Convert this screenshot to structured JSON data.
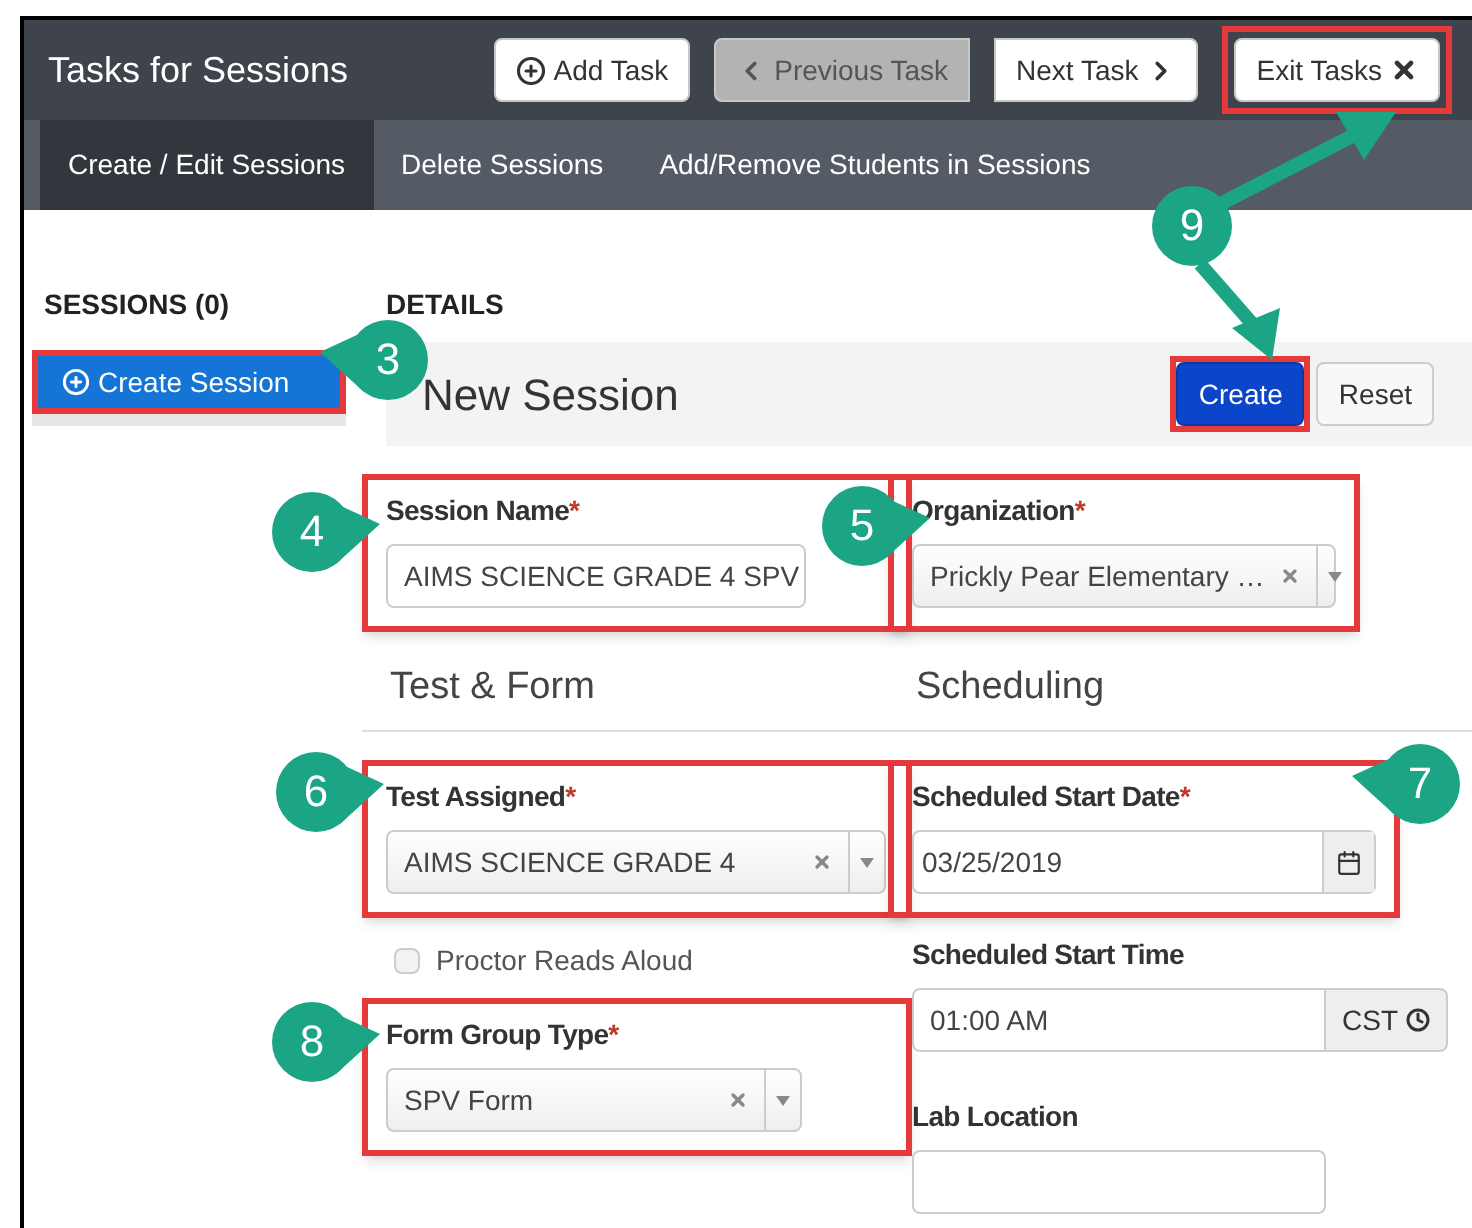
{
  "header": {
    "title": "Tasks for Sessions",
    "buttons": [
      {
        "label": "Add Task",
        "kind": "add",
        "disabled": false,
        "highlighted": false
      },
      {
        "label": "Previous Task",
        "kind": "previous",
        "disabled": true,
        "highlighted": false
      },
      {
        "label": "Next Task",
        "kind": "next",
        "disabled": false,
        "highlighted": false
      },
      {
        "label": "Exit Tasks",
        "kind": "exit",
        "disabled": false,
        "highlighted": true
      }
    ]
  },
  "tabs": [
    {
      "label": "Create / Edit Sessions",
      "selected": true
    },
    {
      "label": "Delete Sessions",
      "selected": false
    },
    {
      "label": "Add/Remove Students in Sessions",
      "selected": false
    }
  ],
  "sessions": {
    "heading": "SESSIONS (0)",
    "create_button": {
      "label": "Create Session",
      "highlighted": true,
      "callout": "3"
    }
  },
  "details": {
    "heading": "DETAILS",
    "title": "New Session",
    "buttons": [
      {
        "label": "Create",
        "kind": "primary",
        "highlighted": true
      },
      {
        "label": "Reset",
        "kind": "default",
        "highlighted": false
      }
    ]
  },
  "left_column": [
    {
      "kind": "text",
      "label": "Session Name",
      "required_mark": "*",
      "value": "AIMS SCIENCE GRADE 4 SPV",
      "highlighted": true,
      "callout": "4"
    },
    {
      "kind": "heading",
      "label": "Test & Form"
    },
    {
      "kind": "select",
      "label": "Test Assigned",
      "required_mark": "*",
      "value": "AIMS SCIENCE GRADE 4",
      "highlighted": true,
      "callout": "6"
    },
    {
      "kind": "checkbox",
      "label": "Proctor Reads Aloud",
      "checked": false,
      "disabled": true
    },
    {
      "kind": "select",
      "label": "Form Group Type",
      "required_mark": "*",
      "value": "SPV Form",
      "highlighted": true,
      "callout": "8"
    }
  ],
  "right_column": [
    {
      "kind": "select",
      "label": "Organization",
      "required_mark": "*",
      "value": "Prickly Pear Elementary …",
      "highlighted": true,
      "callout": "5"
    },
    {
      "kind": "heading",
      "label": "Scheduling"
    },
    {
      "kind": "date",
      "label": "Scheduled Start Date",
      "required_mark": "*",
      "value": "03/25/2019",
      "highlighted": true,
      "callout": "7"
    },
    {
      "kind": "time",
      "label": "Scheduled Start Time",
      "value": "01:00 AM",
      "addon": "CST",
      "highlighted": false
    },
    {
      "kind": "text",
      "label": "Lab Location",
      "highlighted": false
    }
  ],
  "step_marker": {
    "number": "9"
  }
}
